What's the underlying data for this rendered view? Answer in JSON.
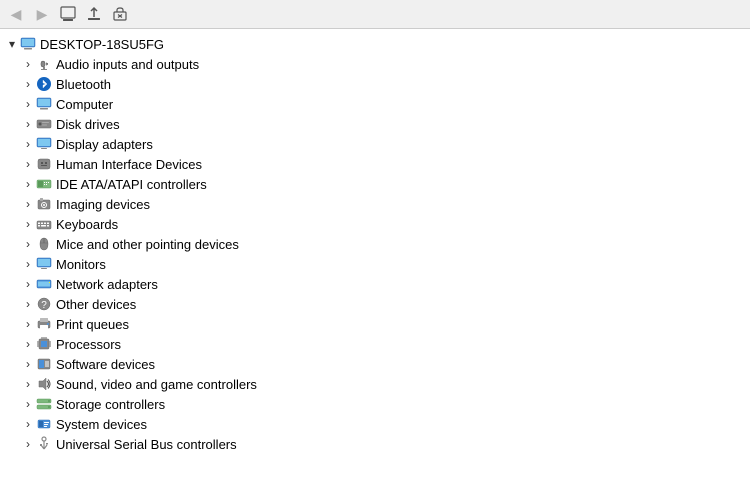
{
  "toolbar": {
    "buttons": [
      {
        "name": "back-button",
        "icon": "◀",
        "disabled": true
      },
      {
        "name": "forward-button",
        "icon": "▶",
        "disabled": true
      },
      {
        "name": "properties-button",
        "icon": "📋",
        "disabled": false
      },
      {
        "name": "update-driver-button",
        "icon": "⬆",
        "disabled": false
      },
      {
        "name": "uninstall-button",
        "icon": "✖",
        "disabled": false
      }
    ]
  },
  "tree": {
    "items": [
      {
        "id": "root",
        "label": "DESKTOP-18SU5FG",
        "indent": 0,
        "expanded": true,
        "arrow": "▾",
        "iconType": "computer"
      },
      {
        "id": "audio",
        "label": "Audio inputs and outputs",
        "indent": 1,
        "expanded": false,
        "arrow": "›",
        "iconType": "audio"
      },
      {
        "id": "bluetooth",
        "label": "Bluetooth",
        "indent": 1,
        "expanded": false,
        "arrow": "›",
        "iconType": "bluetooth"
      },
      {
        "id": "computer",
        "label": "Computer",
        "indent": 1,
        "expanded": false,
        "arrow": "›",
        "iconType": "computer-sm"
      },
      {
        "id": "disk",
        "label": "Disk drives",
        "indent": 1,
        "expanded": false,
        "arrow": "›",
        "iconType": "disk"
      },
      {
        "id": "display",
        "label": "Display adapters",
        "indent": 1,
        "expanded": false,
        "arrow": "›",
        "iconType": "display"
      },
      {
        "id": "hid",
        "label": "Human Interface Devices",
        "indent": 1,
        "expanded": false,
        "arrow": "›",
        "iconType": "hid"
      },
      {
        "id": "ide",
        "label": "IDE ATA/ATAPI controllers",
        "indent": 1,
        "expanded": false,
        "arrow": "›",
        "iconType": "ide"
      },
      {
        "id": "imaging",
        "label": "Imaging devices",
        "indent": 1,
        "expanded": false,
        "arrow": "›",
        "iconType": "imaging"
      },
      {
        "id": "keyboards",
        "label": "Keyboards",
        "indent": 1,
        "expanded": false,
        "arrow": "›",
        "iconType": "keyboard"
      },
      {
        "id": "mice",
        "label": "Mice and other pointing devices",
        "indent": 1,
        "expanded": false,
        "arrow": "›",
        "iconType": "mouse"
      },
      {
        "id": "monitors",
        "label": "Monitors",
        "indent": 1,
        "expanded": false,
        "arrow": "›",
        "iconType": "monitor"
      },
      {
        "id": "network",
        "label": "Network adapters",
        "indent": 1,
        "expanded": false,
        "arrow": "›",
        "iconType": "network"
      },
      {
        "id": "other",
        "label": "Other devices",
        "indent": 1,
        "expanded": false,
        "arrow": "›",
        "iconType": "other"
      },
      {
        "id": "print",
        "label": "Print queues",
        "indent": 1,
        "expanded": false,
        "arrow": "›",
        "iconType": "print"
      },
      {
        "id": "processors",
        "label": "Processors",
        "indent": 1,
        "expanded": false,
        "arrow": "›",
        "iconType": "processor"
      },
      {
        "id": "software",
        "label": "Software devices",
        "indent": 1,
        "expanded": false,
        "arrow": "›",
        "iconType": "software"
      },
      {
        "id": "sound",
        "label": "Sound, video and game controllers",
        "indent": 1,
        "expanded": false,
        "arrow": "›",
        "iconType": "sound"
      },
      {
        "id": "storage",
        "label": "Storage controllers",
        "indent": 1,
        "expanded": false,
        "arrow": "›",
        "iconType": "storage"
      },
      {
        "id": "system",
        "label": "System devices",
        "indent": 1,
        "expanded": false,
        "arrow": "›",
        "iconType": "system"
      },
      {
        "id": "usb",
        "label": "Universal Serial Bus controllers",
        "indent": 1,
        "expanded": false,
        "arrow": "›",
        "iconType": "usb"
      }
    ]
  }
}
